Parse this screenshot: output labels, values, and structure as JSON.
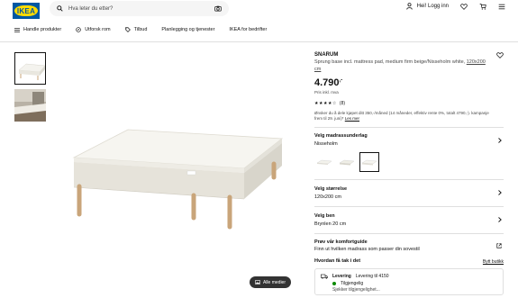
{
  "header": {
    "logo_text": "IKEA",
    "search_placeholder": "Hva leter du etter?",
    "login_label": "Hei! Logg inn"
  },
  "nav": {
    "items": [
      {
        "label": "Handle produkter",
        "icon": "menu-icon"
      },
      {
        "label": "Utforsk rom",
        "icon": "rooms-icon"
      },
      {
        "label": "Tilbud",
        "icon": "tag-icon"
      },
      {
        "label": "Planlegging og tjenester",
        "icon": ""
      },
      {
        "label": "IKEA for bedrifter",
        "icon": ""
      }
    ]
  },
  "gallery": {
    "all_media_label": "Alle medier"
  },
  "product": {
    "name": "SNARUM",
    "description": "Sprung base incl. mattress pad, medium firm beige/Nisseholm white,",
    "size_link": "120x200 cm",
    "price": "4.790",
    "price_suffix": ",-",
    "price_note": "Pris inkl. mva",
    "rating_stars": "★★★★☆",
    "rating_count": "(8)",
    "finance_text": "Ønsker du å dele kjøpet ditt 350,-/måned (14 måneder, effektiv rente 0%, totalt 4790,-). kampanje frem til 29. juni)*",
    "finance_link": "Les mer"
  },
  "options": {
    "pad": {
      "title": "Velg madrassunderlag",
      "value": "Nisseholm"
    },
    "size": {
      "title": "Velg størrelse",
      "value": "120x200 cm"
    },
    "legs": {
      "title": "Velg ben",
      "value": "Brynlen 20 cm"
    },
    "comfort": {
      "title": "Prøv vår komfortguide",
      "value": "Finn ut hvilken madrass som passer din sovestil"
    }
  },
  "delivery": {
    "title": "Hvordan få tak i det",
    "link": "Bytt butikk",
    "item_title": "Levering",
    "item_detail": "Levering til 4150",
    "availability": "Tilgjengelig",
    "check": "Sjekker tilgjengelighet..."
  },
  "colors": {
    "ikea_blue": "#0058a3",
    "ikea_yellow": "#ffdb00",
    "available_green": "#0a8a00"
  }
}
